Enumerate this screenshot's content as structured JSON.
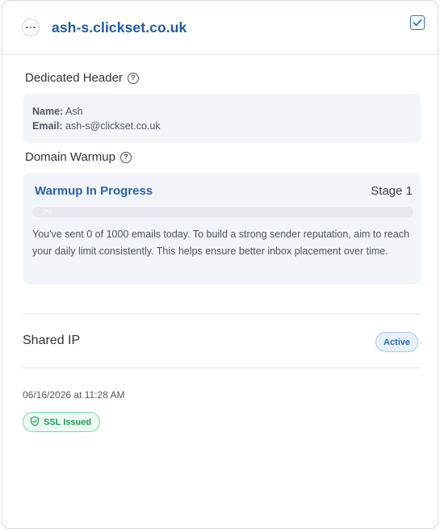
{
  "header": {
    "domain": "ash-s.clickset.co.uk",
    "more_icon": "ellipsis-icon",
    "check_icon": "checkbox-checked-icon"
  },
  "dedicated_header": {
    "title": "Dedicated Header",
    "help_icon": "help-icon",
    "name_label": "Name:",
    "name_value": "Ash",
    "email_label": "Email:",
    "email_value": "ash-s@clickset.co.uk"
  },
  "domain_warmup": {
    "title": "Domain Warmup",
    "help_icon": "help-icon",
    "status": "Warmup In Progress",
    "stage": "Stage 1",
    "progress": 0,
    "progress_label": "0%",
    "description": "You've sent 0 of 1000 emails today. To build a strong sender reputation, aim to reach your daily limit consistently. This helps ensure better inbox placement over time."
  },
  "shared_ip": {
    "label": "Shared IP",
    "badge": "Active"
  },
  "footer": {
    "timestamp": "06/16/2026 at 11:28 AM",
    "ssl_badge": "SSL Issued",
    "ssl_icon": "shield-check-icon"
  },
  "colors": {
    "accent": "#1f5aa6",
    "success": "#1f9a5a",
    "panel_bg": "#f1f5f9"
  }
}
